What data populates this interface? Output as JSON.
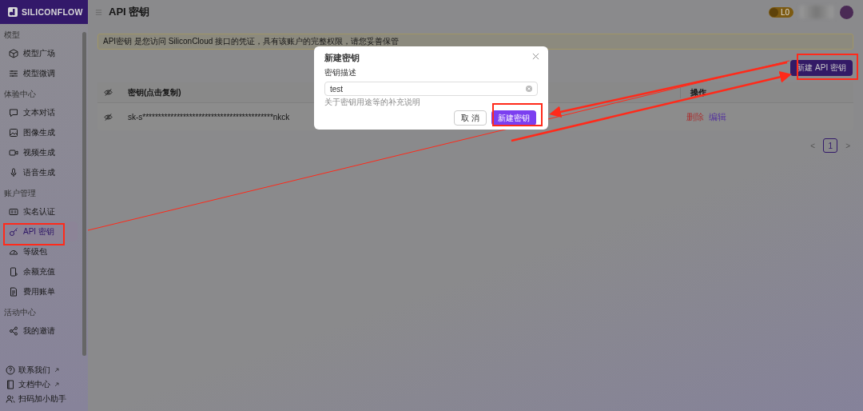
{
  "sidebar": {
    "logo": "SILICONFLOW",
    "sections": [
      {
        "title": "模型",
        "items": [
          {
            "label": "模型广场",
            "selected": false
          },
          {
            "label": "模型微调",
            "selected": false
          }
        ]
      },
      {
        "title": "体验中心",
        "items": [
          {
            "label": "文本对话",
            "selected": false
          },
          {
            "label": "图像生成",
            "selected": false
          },
          {
            "label": "视频生成",
            "selected": false
          },
          {
            "label": "语音生成",
            "selected": false
          }
        ]
      },
      {
        "title": "账户管理",
        "items": [
          {
            "label": "实名认证",
            "selected": false
          },
          {
            "label": "API 密钥",
            "selected": true
          },
          {
            "label": "等级包",
            "selected": false
          },
          {
            "label": "余额充值",
            "selected": false
          },
          {
            "label": "费用账单",
            "selected": false
          }
        ]
      },
      {
        "title": "活动中心",
        "items": [
          {
            "label": "我的邀请",
            "selected": false
          }
        ]
      }
    ],
    "footer": [
      {
        "label": "联系我们",
        "external": true
      },
      {
        "label": "文档中心",
        "external": true
      },
      {
        "label": "扫码加小助手",
        "external": false
      }
    ]
  },
  "header": {
    "title": "API 密钥",
    "level_badge": "L0"
  },
  "alert": "API密钥 是您访问 SiliconCloud 接口的凭证，具有该账户的完整权限，请您妥善保管",
  "create_button": "新建 API 密钥",
  "table": {
    "columns": [
      "密钥(点击复制)",
      "操作"
    ],
    "rows": [
      {
        "key": "sk-s******************************************nkck",
        "actions": [
          {
            "label": "删除",
            "color": "#a83434"
          },
          {
            "label": "编辑",
            "color": "#55349e"
          }
        ]
      }
    ]
  },
  "pagination": {
    "prev": "<",
    "pages": [
      {
        "label": "1",
        "selected": true
      }
    ],
    "next": ">"
  },
  "dialog": {
    "title": "新建密钥",
    "field_label": "密钥描述",
    "value": "test",
    "help": "关于密钥用途等的补充说明",
    "buttons": [
      {
        "label": "取 消",
        "kind": "default"
      },
      {
        "label": "新建密钥",
        "kind": "primary"
      }
    ]
  }
}
